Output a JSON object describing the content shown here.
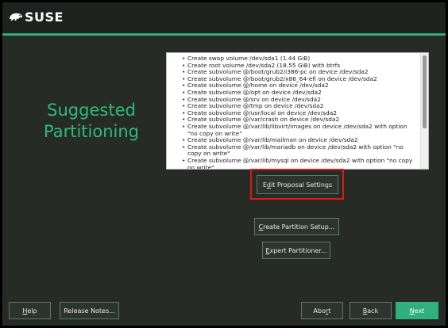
{
  "header": {
    "logo_text": "SUSE",
    "logo_icon": "chameleon-icon",
    "accent_color": "#30ba78"
  },
  "page": {
    "title_line1": "Suggested",
    "title_line2": "Partitioning"
  },
  "proposal_log": [
    "Create swap volume /dev/sda1 (1.44 GiB)",
    "Create root volume /dev/sda2 (18.55 GiB) with btrfs",
    "Create subvolume @/boot/grub2/i386-pc on device /dev/sda2",
    "Create subvolume @/boot/grub2/x86_64-efi on device /dev/sda2",
    "Create subvolume @/home on device /dev/sda2",
    "Create subvolume @/opt on device /dev/sda2",
    "Create subvolume @/srv on device /dev/sda2",
    "Create subvolume @/tmp on device /dev/sda2",
    "Create subvolume @/usr/local on device /dev/sda2",
    "Create subvolume @/var/crash on device /dev/sda2",
    "Create subvolume @/var/lib/libvirt/images on device /dev/sda2 with option \"no copy on write\"",
    "Create subvolume @/var/lib/mailman on device /dev/sda2",
    "Create subvolume @/var/lib/mariadb on device /dev/sda2 with option \"no copy on write\"",
    "Create subvolume @/var/lib/mysql on device /dev/sda2 with option \"no copy on write\""
  ],
  "buttons": {
    "edit_proposal": {
      "pre": "E",
      "accel": "d",
      "post": "it Proposal Settings"
    },
    "create_partition": {
      "pre": "",
      "accel": "C",
      "post": "reate Partition Setup..."
    },
    "expert_partitioner": {
      "pre": "",
      "accel": "E",
      "post": "xpert Partitioner..."
    },
    "help": {
      "pre": "",
      "accel": "H",
      "post": "elp"
    },
    "release_notes": {
      "pre": "Release Notes...",
      "accel": "",
      "post": ""
    },
    "abort": {
      "pre": "Abo",
      "accel": "r",
      "post": "t"
    },
    "back": {
      "pre": "",
      "accel": "B",
      "post": "ack"
    },
    "next": {
      "pre": "",
      "accel": "N",
      "post": "ext"
    }
  }
}
